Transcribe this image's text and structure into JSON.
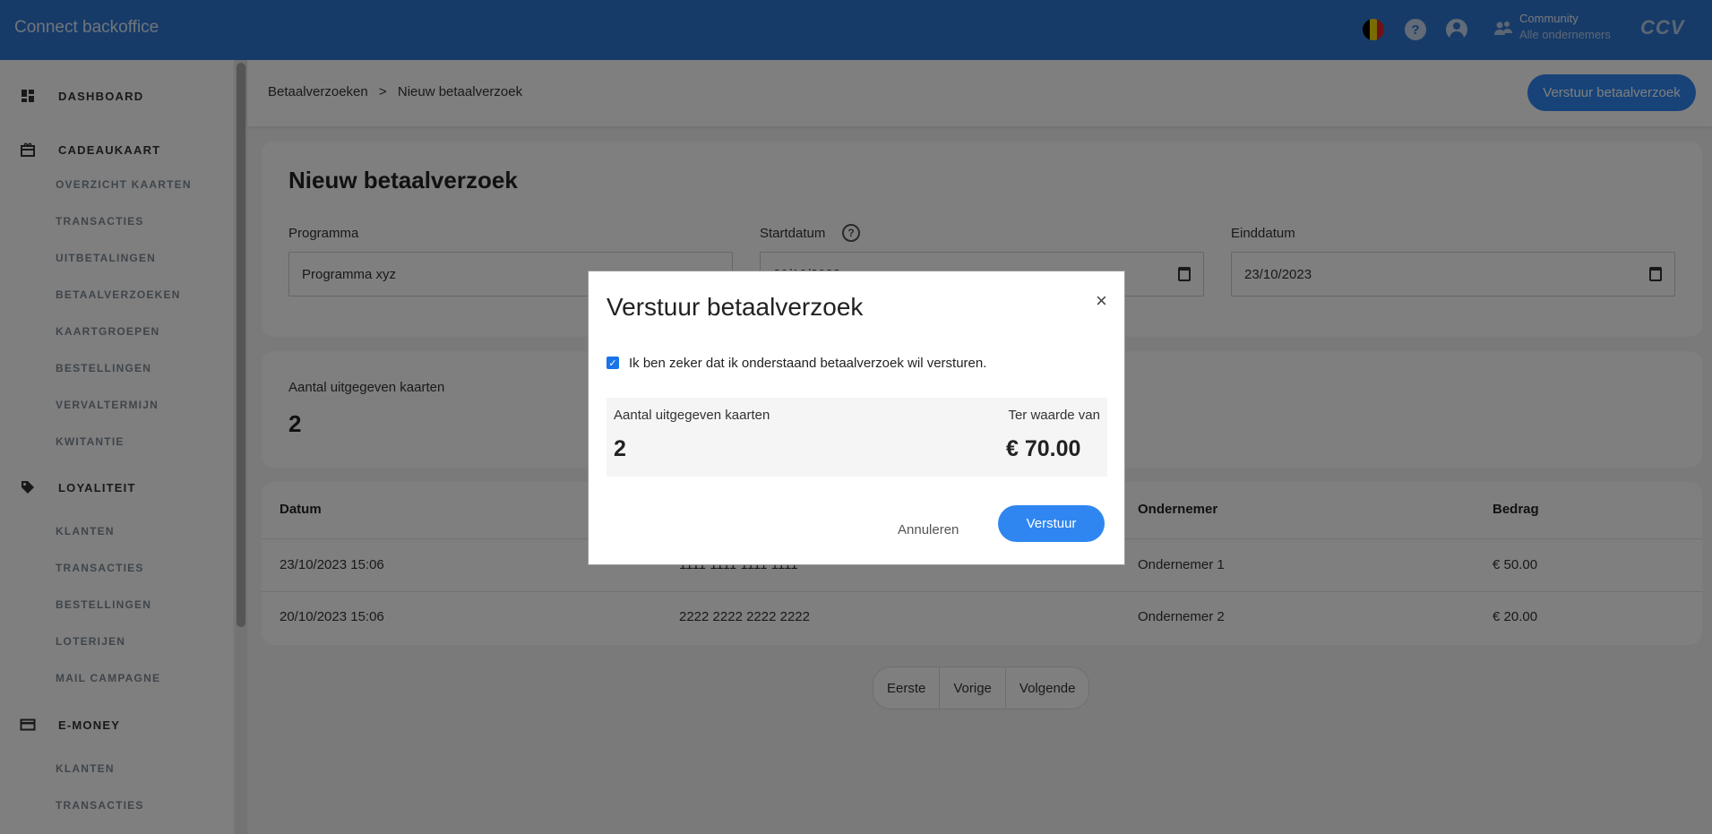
{
  "topbar": {
    "app_title": "Connect backoffice",
    "community_title": "Community",
    "community_subtitle": "Alle ondernemers",
    "logo_text": "CCV",
    "help_glyph": "?",
    "icons": [
      "belgium-flag-icon",
      "help-icon",
      "user-icon",
      "community-icon"
    ],
    "flag_colors": [
      "#000000",
      "#f5d90a",
      "#e0242b"
    ]
  },
  "sidebar": {
    "sections": [
      {
        "label": "DASHBOARD",
        "icon": "dashboard-icon",
        "items": []
      },
      {
        "label": "CADEAUKAART",
        "icon": "gift-card-icon",
        "items": [
          "OVERZICHT KAARTEN",
          "TRANSACTIES",
          "UITBETALINGEN",
          "BETAALVERZOEKEN",
          "KAARTGROEPEN",
          "BESTELLINGEN",
          "VERVALTERMIJN",
          "KWITANTIE"
        ]
      },
      {
        "label": "LOYALITEIT",
        "icon": "tag-icon",
        "items": [
          "KLANTEN",
          "TRANSACTIES",
          "BESTELLINGEN",
          "LOTERIJEN",
          "MAIL CAMPAGNE"
        ]
      },
      {
        "label": "E-MONEY",
        "icon": "card-icon",
        "items": [
          "KLANTEN",
          "TRANSACTIES"
        ]
      }
    ]
  },
  "header": {
    "breadcrumb": [
      "Betaalverzoeken",
      ">",
      "Nieuw betaalverzoek"
    ],
    "primary_button": "Verstuur betaalverzoek"
  },
  "form": {
    "title": "Nieuw betaalverzoek",
    "programma_label": "Programma",
    "programma_value": "Programma xyz",
    "startdatum_label": "Startdatum",
    "startdatum_value": "20/10/2023",
    "help_glyph": "?",
    "einddatum_label": "Einddatum",
    "einddatum_value": "23/10/2023"
  },
  "stats": {
    "label": "Aantal uitgegeven kaarten",
    "value": "2"
  },
  "table": {
    "headers": [
      "Datum",
      "Ondernemer",
      "Bedrag"
    ],
    "rows": [
      {
        "datum": "23/10/2023 15:06",
        "kaart": "1111 1111 1111 1111",
        "ondernemer": "Ondernemer 1",
        "bedrag": "€ 50.00"
      },
      {
        "datum": "20/10/2023 15:06",
        "kaart": "2222 2222 2222 2222",
        "ondernemer": "Ondernemer 2",
        "bedrag": "€ 20.00"
      }
    ]
  },
  "pagination": {
    "first": "Eerste",
    "prev": "Vorige",
    "next": "Volgende"
  },
  "modal": {
    "title": "Verstuur betaalverzoek",
    "close": "×",
    "checkbox_mark": "✓",
    "checkbox_label": "Ik ben zeker dat ik onderstaand betaalverzoek wil versturen.",
    "checked": true,
    "count_label": "Aantal uitgegeven kaarten",
    "count_value": "2",
    "value_label": "Ter waarde van",
    "value_amount": "€ 70.00",
    "cancel": "Annuleren",
    "submit": "Verstuur"
  },
  "colors": {
    "topbar": "#2e77d0",
    "accent": "#2f86f0"
  }
}
